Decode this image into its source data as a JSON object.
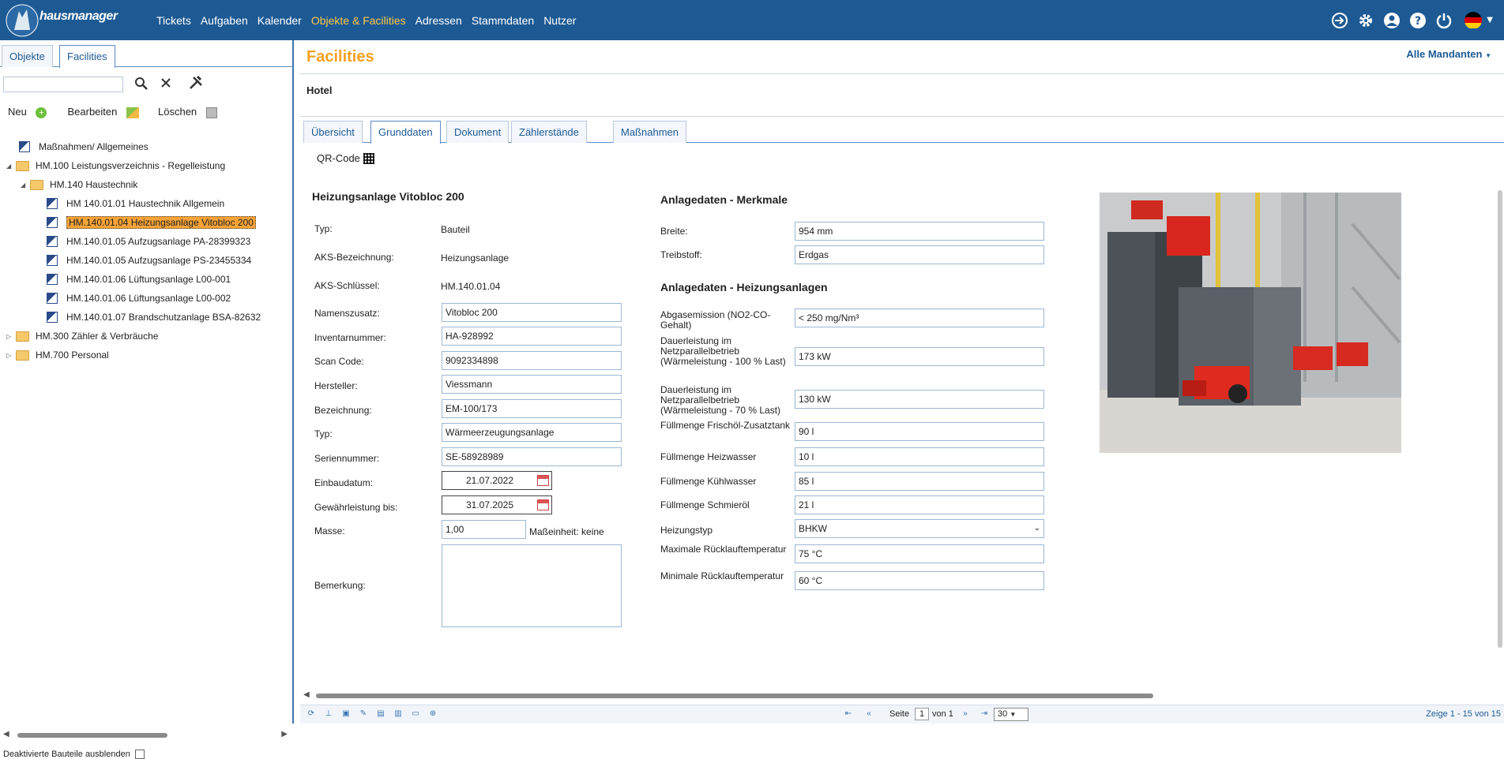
{
  "app": {
    "logo_text": "hausmanager"
  },
  "nav": {
    "items": [
      "Tickets",
      "Aufgaben",
      "Kalender",
      "Objekte & Facilities",
      "Adressen",
      "Stammdaten",
      "Nutzer"
    ],
    "active": "Objekte & Facilities"
  },
  "left": {
    "tabs": [
      "Objekte",
      "Facilities"
    ],
    "actions": {
      "new": "Neu",
      "edit": "Bearbeiten",
      "delete": "Löschen"
    },
    "tree": [
      "Maßnahmen/ Allgemeines",
      "HM.100 Leistungsverzeichnis - Regelleistung",
      "HM.140 Haustechnik",
      "HM 140.01.01 Haustechnik Allgemein",
      "HM.140.01.04 Heizungsanlage Vitobloc 200",
      "HM.140.01.05 Aufzugsanlage PA-28399323",
      "HM.140.01.05 Aufzugsanlage PS-23455334",
      "HM.140.01.06 Lüftungsanlage L00-001",
      "HM.140.01.06 Lüftungsanlage L00-002",
      "HM.140.01.07 Brandschutzanlage BSA-82632",
      "HM.300 Zähler & Verbräuche",
      "HM.700 Personal"
    ],
    "deactivated_label": "Deaktivierte Bauteile ausblenden"
  },
  "main": {
    "title": "Facilities",
    "mandant": "Alle Mandanten",
    "object": "Hotel",
    "tabs": [
      "Übersicht",
      "Grunddaten",
      "Dokument",
      "Zählerstände",
      "Maßnahmen"
    ],
    "qr_label": "QR-Code",
    "left_section": {
      "heading": "Heizungsanlage Vitobloc 200",
      "static": [
        {
          "label": "Typ:",
          "value": "Bauteil"
        },
        {
          "label": "AKS-Bezeichnung:",
          "value": "Heizungsanlage"
        },
        {
          "label": "AKS-Schlüssel:",
          "value": "HM.140.01.04"
        }
      ],
      "fields": [
        {
          "label": "Namenszusatz:",
          "value": "Vitobloc 200"
        },
        {
          "label": "Inventarnummer:",
          "value": "HA-928992"
        },
        {
          "label": "Scan Code:",
          "value": "9092334898"
        },
        {
          "label": "Hersteller:",
          "value": "Viessmann"
        },
        {
          "label": "Bezeichnung:",
          "value": "EM-100/173"
        },
        {
          "label": "Typ:",
          "value": "Wärmeerzeugungsanlage"
        },
        {
          "label": "Seriennummer:",
          "value": "SE-58928989"
        }
      ],
      "einbaudatum": {
        "label": "Einbaudatum:",
        "value": "21.07.2022"
      },
      "gewaehrleistung": {
        "label": "Gewährleistung bis:",
        "value": "31.07.2025"
      },
      "masse": {
        "label": "Masse:",
        "value": "1,00",
        "unit_label": "Maßeinheit: keine"
      },
      "bemerkung": {
        "label": "Bemerkung:",
        "value": ""
      }
    },
    "merkmale": {
      "heading": "Anlagedaten - Merkmale",
      "fields": [
        {
          "label": "Breite:",
          "value": "954 mm"
        },
        {
          "label": "Treibstoff:",
          "value": "Erdgas"
        }
      ]
    },
    "heizung": {
      "heading": "Anlagedaten - Heizungsanlagen",
      "fields": [
        {
          "label": "Abgasemission (NO2-CO-Gehalt)",
          "value": "< 250 mg/Nm³"
        },
        {
          "label": "Dauerleistung im Netzparallelbetrieb (Wärmeleistung - 100 % Last)",
          "value": "173 kW"
        },
        {
          "label": "Dauerleistung im Netzparallelbetrieb (Wärmeleistung - 70 % Last)",
          "value": "130 kW"
        },
        {
          "label": "Füllmenge Frischöl-Zusatztank",
          "value": "90 l"
        },
        {
          "label": "Füllmenge Heizwasser",
          "value": "10 l"
        },
        {
          "label": "Füllmenge Kühlwasser",
          "value": "85 l"
        },
        {
          "label": "Füllmenge Schmieröl",
          "value": "21 l"
        },
        {
          "label": "Heizungstyp",
          "value": "BHKW"
        },
        {
          "label": "Maximale Rücklauftemperatur",
          "value": "75 °C"
        },
        {
          "label": "Minimale Rücklauftemperatur",
          "value": "60 °C"
        }
      ]
    },
    "pager": {
      "page_label": "Seite",
      "page": "1",
      "of_label": "von 1",
      "page_size": "30",
      "summary": "Zeige 1 - 15 von 15"
    }
  }
}
